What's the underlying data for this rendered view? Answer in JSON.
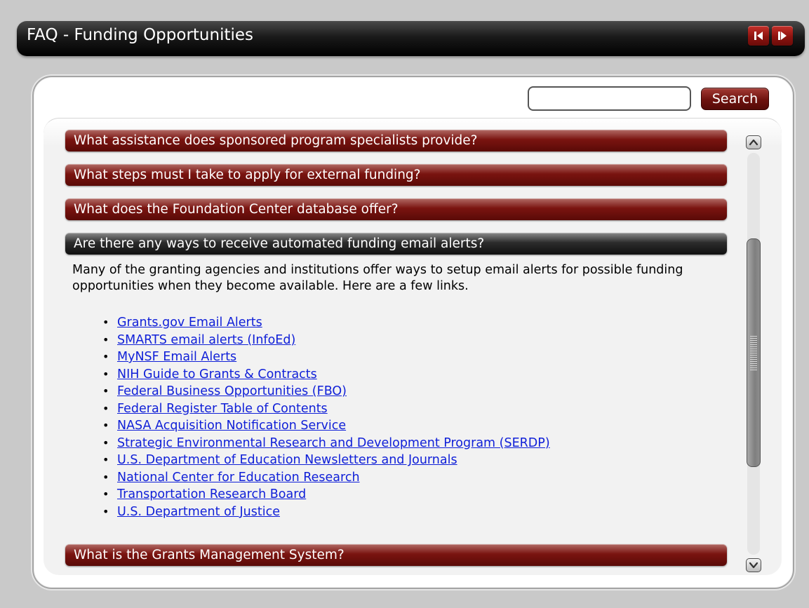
{
  "window": {
    "title": "FAQ - Funding Opportunities",
    "prev_icon": "previous-icon",
    "next_icon": "next-icon"
  },
  "search": {
    "value": "",
    "placeholder": "",
    "button_label": "Search"
  },
  "faq": {
    "items": [
      {
        "question": "What assistance does sponsored program specialists provide?",
        "expanded": false
      },
      {
        "question": "What steps must I take to apply for external funding?",
        "expanded": false
      },
      {
        "question": "What does the Foundation Center database offer?",
        "expanded": false
      },
      {
        "question": "Are there any ways to receive automated funding email alerts?",
        "expanded": true,
        "answer": "Many of the granting agencies and institutions offer ways to setup email alerts for possible funding opportunities when they become available. Here are a few links.",
        "links": [
          "Grants.gov Email Alerts",
          "SMARTS email alerts (InfoEd)",
          "MyNSF Email Alerts",
          "NIH Guide to Grants & Contracts",
          "Federal Business Opportunities (FBO)",
          "Federal Register Table of Contents",
          "NASA Acquisition Notification Service",
          "Strategic Environmental Research and Development Program (SERDP)",
          "U.S. Department of Education Newsletters and Journals",
          "National Center for Education Research",
          "Transportation Research Board",
          "U.S. Department of Justice"
        ]
      },
      {
        "question": "What is the Grants Management System?",
        "expanded": false
      }
    ]
  },
  "scrollbar": {
    "up_icon": "chevron-up-icon",
    "down_icon": "chevron-down-icon",
    "position_fraction": 0.21
  },
  "colors": {
    "background": "#c9c9c9",
    "title_bar": "#000000",
    "accent_dark_red": "#6e120e",
    "open_header": "#2c2c2c",
    "link": "#1020d8"
  }
}
